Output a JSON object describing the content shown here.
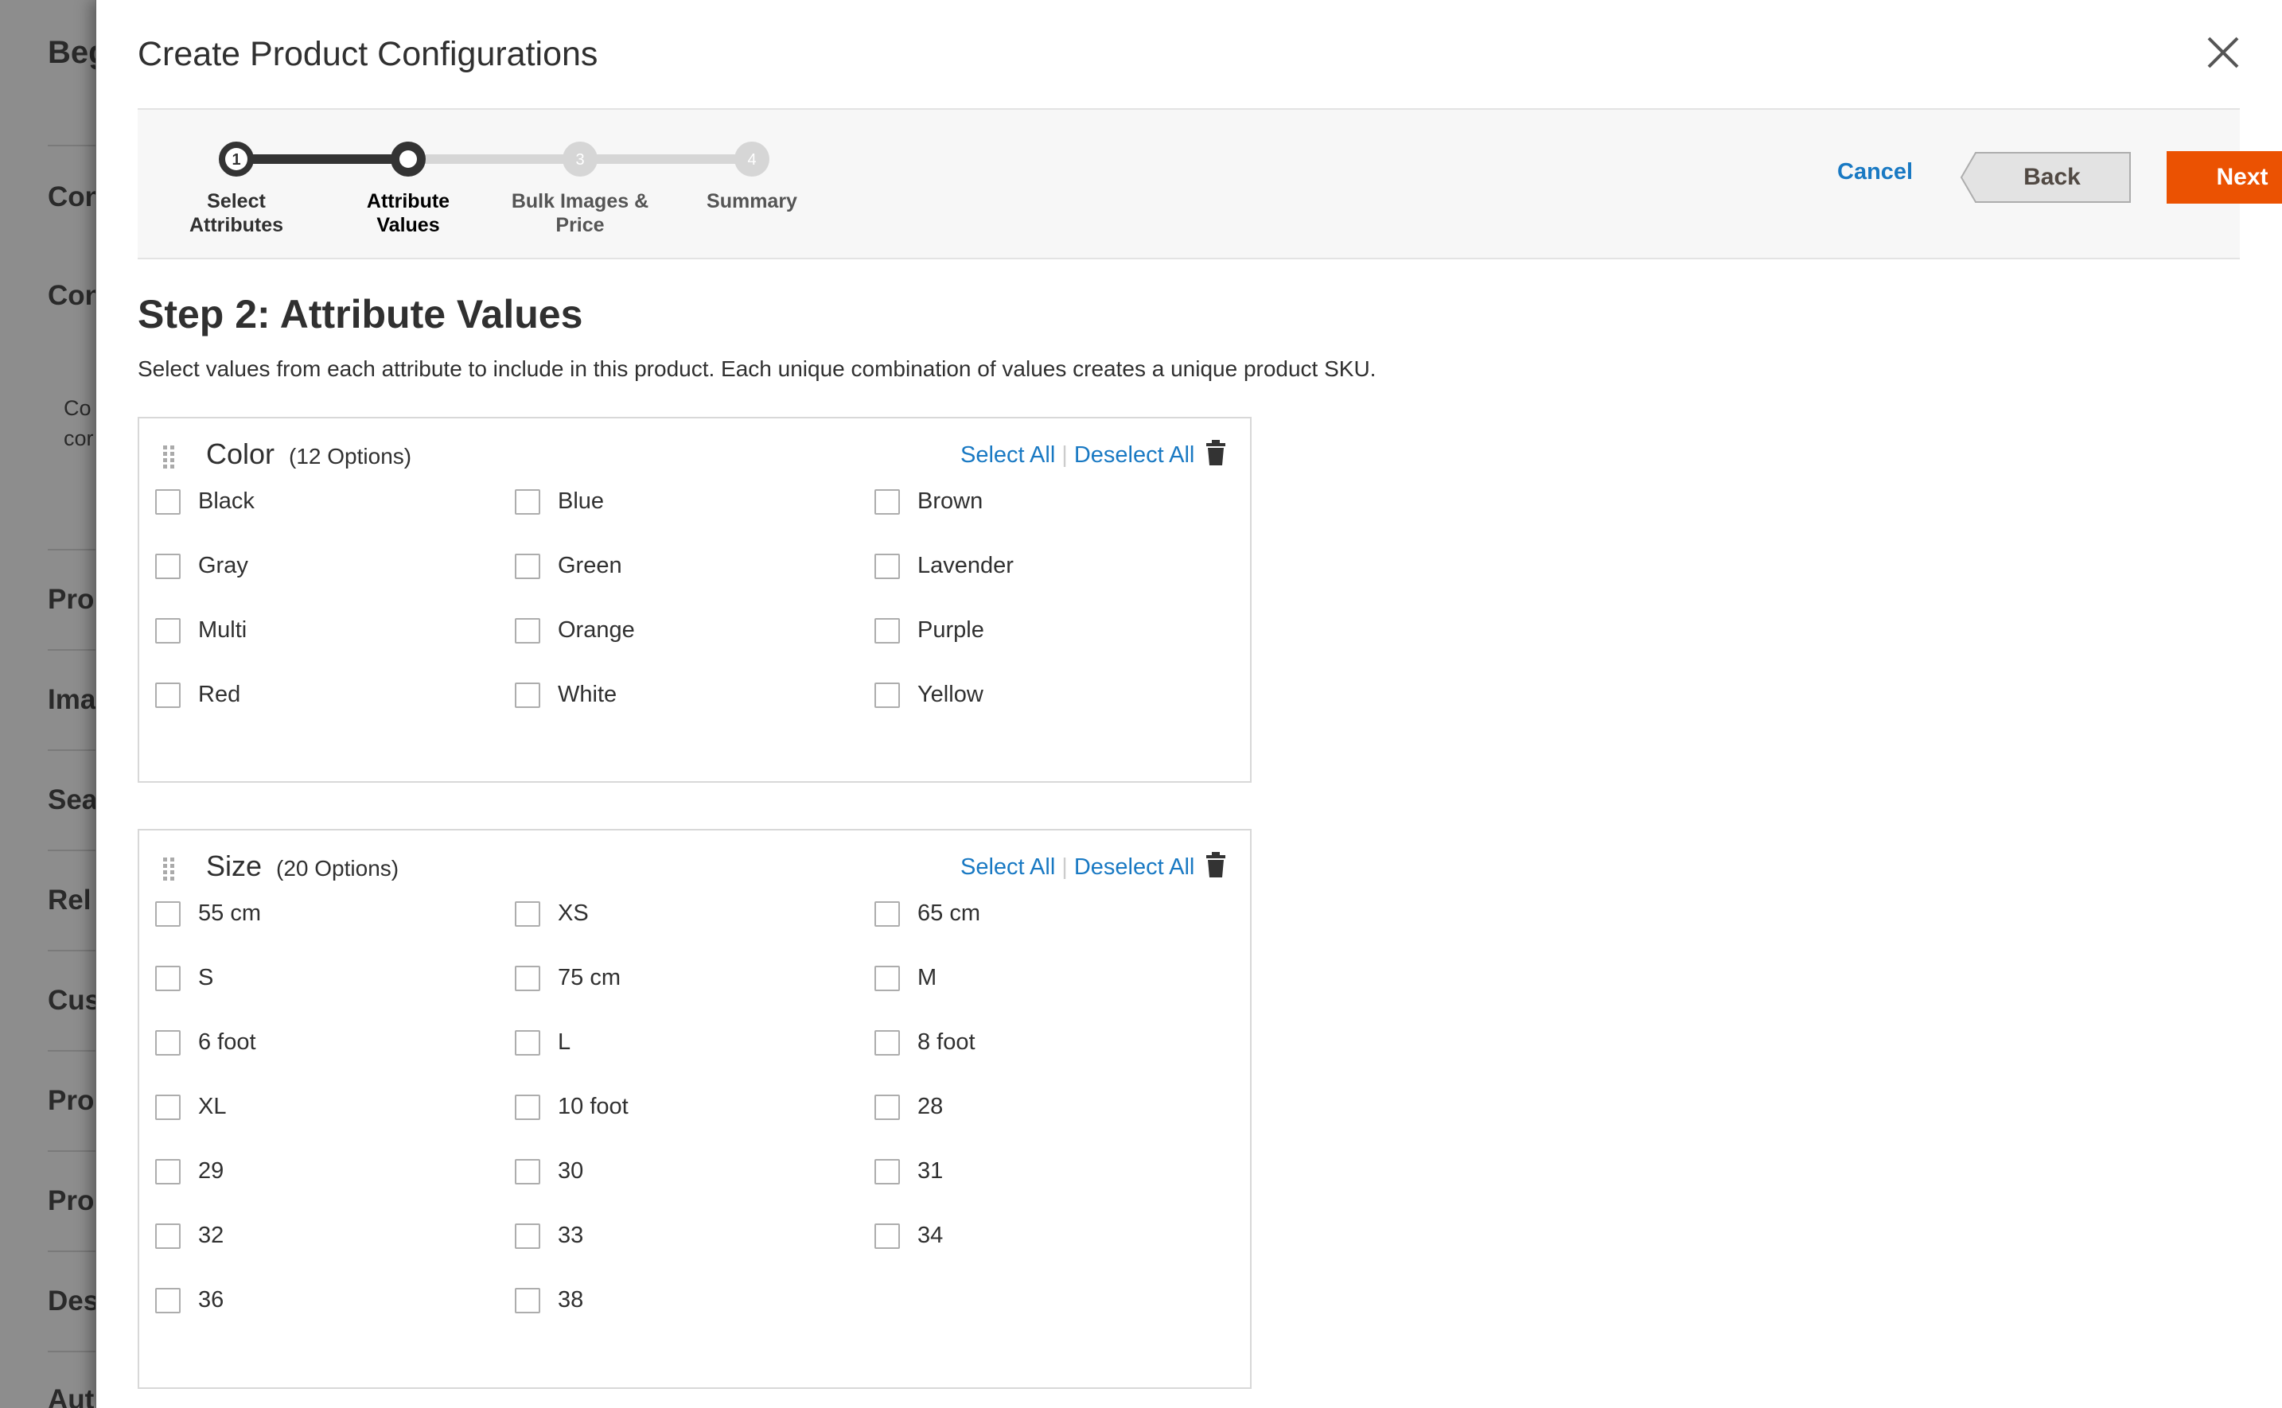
{
  "background": {
    "title": "Beg",
    "items": [
      "Con",
      "Con",
      "Pro",
      "Ima",
      "Sea",
      "Rel",
      "Cus",
      "Pro",
      "Pro",
      "Des",
      "Aut"
    ],
    "small_text": [
      "Co",
      "cor"
    ]
  },
  "modal": {
    "title": "Create Product Configurations",
    "close_icon": "close-icon"
  },
  "wizard": {
    "steps": [
      {
        "number": "1",
        "label_line1": "Select",
        "label_line2": "Attributes",
        "state": "completed"
      },
      {
        "number": "",
        "label_line1": "Attribute",
        "label_line2": "Values",
        "state": "active"
      },
      {
        "number": "3",
        "label_line1": "Bulk Images &",
        "label_line2": "Price",
        "state": "upcoming"
      },
      {
        "number": "4",
        "label_line1": "Summary",
        "label_line2": "",
        "state": "upcoming"
      }
    ],
    "cancel_label": "Cancel",
    "back_label": "Back",
    "next_label": "Next"
  },
  "colors": {
    "accent_orange": "#eb5202",
    "link_blue": "#1979c3",
    "step_dark": "#333333",
    "step_inactive": "#d6d6d6"
  },
  "step_heading": "Step 2: Attribute Values",
  "step_description": "Select values from each attribute to include in this product. Each unique combination of values creates a unique product SKU.",
  "attributes": [
    {
      "name": "Color",
      "count": "(12 Options)",
      "select_all": "Select All",
      "deselect_all": "Deselect All",
      "options": [
        "Black",
        "Blue",
        "Brown",
        "Gray",
        "Green",
        "Lavender",
        "Multi",
        "Orange",
        "Purple",
        "Red",
        "White",
        "Yellow"
      ]
    },
    {
      "name": "Size",
      "count": "(20 Options)",
      "select_all": "Select All",
      "deselect_all": "Deselect All",
      "options": [
        "55 cm",
        "XS",
        "65 cm",
        "S",
        "75 cm",
        "M",
        "6 foot",
        "L",
        "8 foot",
        "XL",
        "10 foot",
        "28",
        "29",
        "30",
        "31",
        "32",
        "33",
        "34",
        "36",
        "38"
      ]
    }
  ]
}
